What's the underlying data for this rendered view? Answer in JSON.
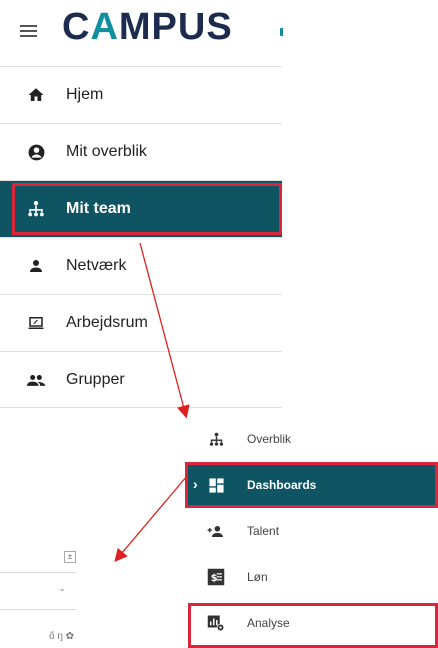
{
  "header": {
    "logo_prefix": "C",
    "logo_accent": "A",
    "logo_rest": "MPUS"
  },
  "nav": {
    "items": [
      {
        "label": "Hjem",
        "icon": "home-icon"
      },
      {
        "label": "Mit overblik",
        "icon": "account-icon"
      },
      {
        "label": "Mit team",
        "icon": "team-hierarchy-icon",
        "active": true
      },
      {
        "label": "Netværk",
        "icon": "person-icon"
      },
      {
        "label": "Arbejdsrum",
        "icon": "laptop-icon"
      },
      {
        "label": "Grupper",
        "icon": "group-icon"
      }
    ]
  },
  "submenu": {
    "items": [
      {
        "label": "Overblik",
        "icon": "team-hierarchy-icon"
      },
      {
        "label": "Dashboards",
        "icon": "dashboard-icon",
        "active": true
      },
      {
        "label": "Talent",
        "icon": "add-person-icon"
      },
      {
        "label": "Løn",
        "icon": "salary-icon"
      },
      {
        "label": "Analyse",
        "icon": "analytics-settings-icon",
        "highlighted": true
      }
    ]
  },
  "fragments": {
    "bottom_text": "ő ŋ ✿"
  },
  "colors": {
    "active_bg": "#0e5462",
    "highlight_red": "#d9263a",
    "logo_dark": "#1d2b4f",
    "logo_accent": "#0f8fa0"
  }
}
